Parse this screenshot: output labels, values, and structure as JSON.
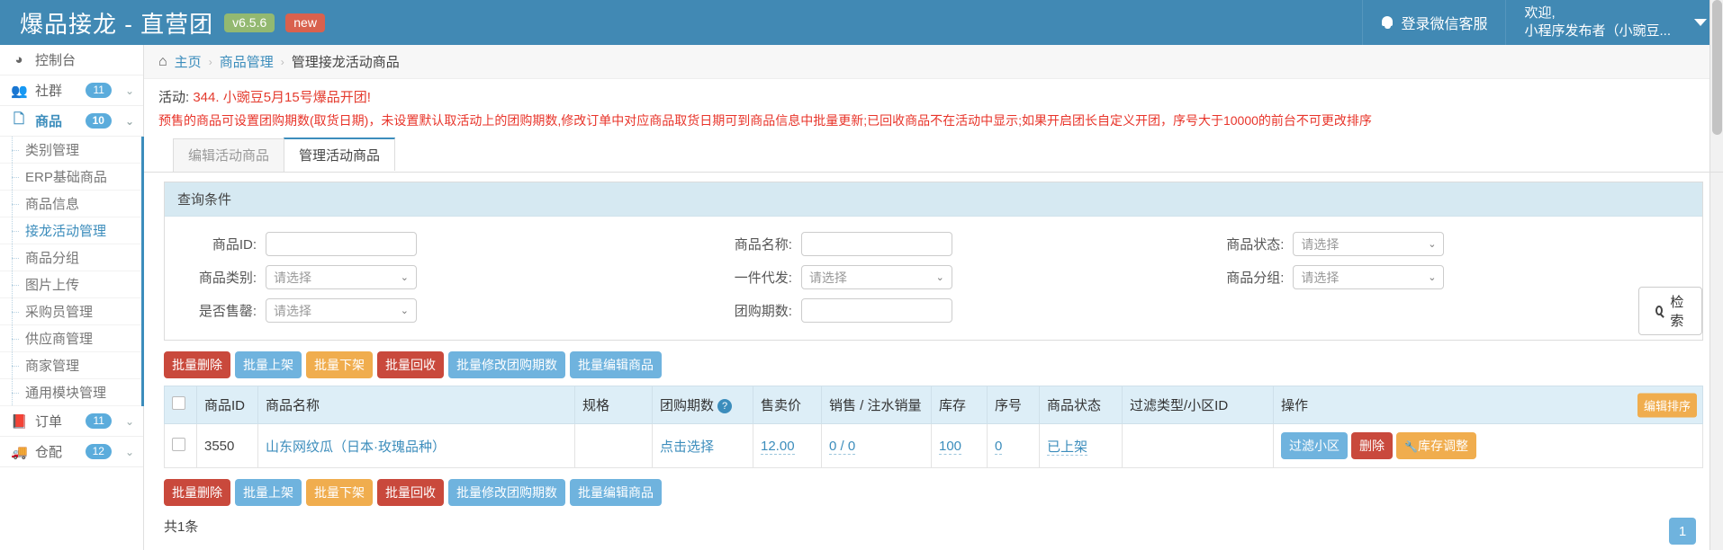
{
  "header": {
    "brand_title": "爆品接龙 - 直营团",
    "version_badge": "v6.5.6",
    "new_badge": "new",
    "wechat_support": "登录微信客服",
    "welcome_line1": "欢迎,",
    "welcome_line2": "小程序发布者（小豌豆...",
    "bell_icon": "bell-icon",
    "caret_icon": "chevron-down-icon"
  },
  "sidebar": {
    "items": [
      {
        "label": "控制台",
        "icon": "dashboard-icon",
        "badge": "",
        "has_chevron": false,
        "active": false
      },
      {
        "label": "社群",
        "icon": "users-icon",
        "badge": "11",
        "has_chevron": true,
        "active": false
      },
      {
        "label": "商品",
        "icon": "file-icon",
        "badge": "10",
        "has_chevron": true,
        "active": true
      }
    ],
    "sub_items": [
      {
        "label": "类别管理",
        "selected": false
      },
      {
        "label": "ERP基础商品",
        "selected": false
      },
      {
        "label": "商品信息",
        "selected": false
      },
      {
        "label": "接龙活动管理",
        "selected": true
      },
      {
        "label": "商品分组",
        "selected": false
      },
      {
        "label": "图片上传",
        "selected": false
      },
      {
        "label": "采购员管理",
        "selected": false
      },
      {
        "label": "供应商管理",
        "selected": false
      },
      {
        "label": "商家管理",
        "selected": false
      },
      {
        "label": "通用模块管理",
        "selected": false
      }
    ],
    "items_bottom": [
      {
        "label": "订单",
        "icon": "book-icon",
        "badge": "11",
        "has_chevron": true
      },
      {
        "label": "仓配",
        "icon": "truck-icon",
        "badge": "12",
        "has_chevron": true
      }
    ]
  },
  "breadcrumb": {
    "home_icon": "home-icon",
    "home": "主页",
    "level2": "商品管理",
    "current": "管理接龙活动商品",
    "separator": "›"
  },
  "activity": {
    "prefix": "活动:",
    "name": "344. 小豌豆5月15号爆品开团!",
    "warning": "预售的商品可设置团购期数(取货日期)，未设置默认取活动上的团购期数,修改订单中对应商品取货日期可到商品信息中批量更新;已回收商品不在活动中显示;如果开启团长自定义开团，序号大于10000的前台不可更改排序"
  },
  "tabs": [
    {
      "label": "编辑活动商品",
      "active": false
    },
    {
      "label": "管理活动商品",
      "active": true
    }
  ],
  "query_panel": {
    "title": "查询条件",
    "fields": [
      {
        "label": "商品ID:",
        "type": "input",
        "value": "",
        "placeholder": ""
      },
      {
        "label": "商品名称:",
        "type": "input",
        "value": "",
        "placeholder": ""
      },
      {
        "label": "商品状态:",
        "type": "select",
        "value": "请选择"
      },
      {
        "label": "商品类别:",
        "type": "select",
        "value": "请选择"
      },
      {
        "label": "一件代发:",
        "type": "select",
        "value": "请选择"
      },
      {
        "label": "商品分组:",
        "type": "select",
        "value": "请选择"
      },
      {
        "label": "是否售罄:",
        "type": "select",
        "value": "请选择"
      },
      {
        "label": "团购期数:",
        "type": "input",
        "value": "",
        "placeholder": ""
      }
    ],
    "search_button": "检 索",
    "search_icon": "search-icon"
  },
  "bulk_buttons": [
    {
      "label": "批量删除",
      "style": "red"
    },
    {
      "label": "批量上架",
      "style": "blue"
    },
    {
      "label": "批量下架",
      "style": "orange"
    },
    {
      "label": "批量回收",
      "style": "red"
    },
    {
      "label": "批量修改团购期数",
      "style": "blue"
    },
    {
      "label": "批量编辑商品",
      "style": "blue"
    }
  ],
  "table": {
    "headers": [
      "",
      "商品ID",
      "商品名称",
      "规格",
      "团购期数",
      "售卖价",
      "销售 / 注水销量",
      "库存",
      "序号",
      "商品状态",
      "过滤类型/小区ID",
      "操作"
    ],
    "help_icon": "question-mark-icon",
    "sort_button": "编辑排序",
    "rows": [
      {
        "product_id": "3550",
        "product_name": "山东网纹瓜（日本·玫瑰品种）",
        "spec": "",
        "period": "点击选择",
        "price": "12.00",
        "sales": "0 / 0",
        "stock": "100",
        "seq": "0",
        "status": "已上架",
        "filter": "",
        "actions": [
          {
            "label": "过滤小区",
            "style": "blue"
          },
          {
            "label": "删除",
            "style": "red"
          },
          {
            "label": "库存调整",
            "style": "orange",
            "icon": "wrench-icon"
          }
        ]
      }
    ]
  },
  "footer": {
    "total": "共1条",
    "current_page": "1"
  },
  "colors": {
    "header_blue": "#4189b4",
    "accent_blue": "#3c8dbc",
    "danger_red": "#c9493c",
    "warn_orange": "#f0ad4e",
    "alert_red": "#e8342a"
  }
}
